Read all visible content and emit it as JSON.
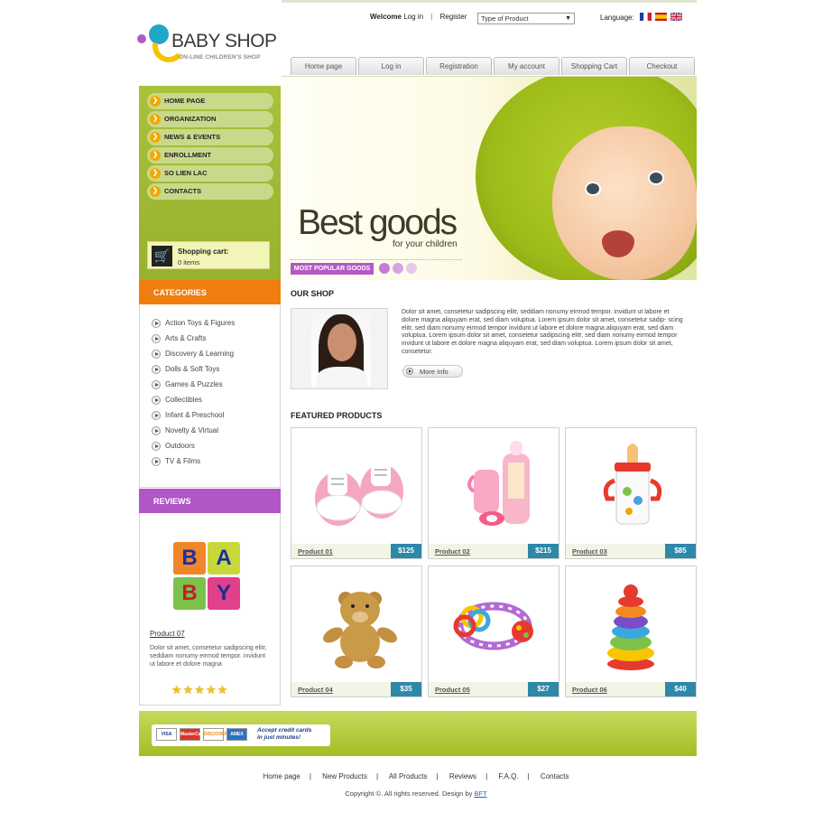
{
  "header": {
    "logo_text": "BABY SHOP",
    "logo_tagline": "ON-LINE CHILDREN'S SHOP",
    "welcome": "Welcome",
    "login_link": "Log in",
    "separator": "|",
    "register_link": "Register",
    "product_type_select": "Type of Product",
    "language_label": "Language:",
    "flags": [
      "fr-flag-icon",
      "es-flag-icon",
      "uk-flag-icon"
    ]
  },
  "top_nav": [
    "Home page",
    "Log in",
    "Registration",
    "My account",
    "Shopping Cart",
    "Checkout"
  ],
  "side_menu": [
    "HOME PAGE",
    "ORGANIZATION",
    "NEWS & EVENTS",
    "ENROLLMENT",
    "SO LIEN LAC",
    "CONTACTS"
  ],
  "cart": {
    "title": "Shopping cart:",
    "count": "0 items"
  },
  "categories": {
    "title": "CATEGORIES",
    "items": [
      "Action Toys & Figures",
      "Arts & Crafts",
      "Discovery & Learning",
      "Dolls & Soft Toys",
      "Games & Puzzles",
      "Collectibles",
      "Infant & Preschool",
      "Novelty & Virtual",
      "Outdoors",
      "TV & Films"
    ]
  },
  "reviews": {
    "title": "REVIEWS",
    "blocks": [
      "B",
      "A",
      "B",
      "Y"
    ],
    "product": "Product 07",
    "text": "Dolor sit amet, consetetur sadipscing elitr, seddiam nonumy eirmod tempor. invidunt ut labore et dolore magna",
    "stars": 5,
    "stars_glyph": "★★★★★"
  },
  "banner": {
    "headline": "Best goods",
    "sub": "for your children",
    "tag": "MOST POPULAR GOODS"
  },
  "our_shop": {
    "title": "OUR SHOP",
    "text": "Dolor sit amet, consetetur sadipscing elitr, seddiam nonumy eirmod tempor. invidunt ut labore et dolore magna aliquyam erat, sed diam voluptua. Lorem ipsum dolor sit amet, consetetur sadip- scing elitr, sed diam nonumy eirmod tempor invidunt ut labore et dolore magna aliquyam erat, sed diam voluptua. Lorem ipsum dolor sit amet, consetetur sadipscing elitr, sed diam nonumy eirmod tempor invidunt ut labore et dolore magna aliquyam erat, sed diam voluptua. Lorem ipsum dolor sit amet, consetetur.",
    "more_info": "More Info"
  },
  "featured": {
    "title": "FEATURED PRODUCTS",
    "products": [
      {
        "name": "Product 01",
        "price": "$125",
        "icon": "baby-shoes-icon"
      },
      {
        "name": "Product 02",
        "price": "$215",
        "icon": "baby-bottle-set-icon"
      },
      {
        "name": "Product 03",
        "price": "$85",
        "icon": "sippy-cup-icon"
      },
      {
        "name": "Product 04",
        "price": "$35",
        "icon": "teddy-bear-icon"
      },
      {
        "name": "Product 05",
        "price": "$27",
        "icon": "rattle-ring-icon"
      },
      {
        "name": "Product 06",
        "price": "$40",
        "icon": "stacking-rings-icon"
      }
    ]
  },
  "payment": {
    "cards": [
      "VISA",
      "MasterCard",
      "DISCOVER",
      "AMEX"
    ],
    "line1": "Accept credit cards",
    "line2": "in just minutes!"
  },
  "footer": {
    "links": [
      "Home page",
      "New Products",
      "All Products",
      "Reviews",
      "F.A.Q.",
      "Contacts"
    ],
    "copyright": "Copyright ©. All rights reserved. Design by",
    "design_by": "BFT"
  },
  "colors": {
    "green": "#a8c23a",
    "orange": "#f07e0e",
    "purple": "#b156c5",
    "price_blue": "#2e88a8"
  }
}
